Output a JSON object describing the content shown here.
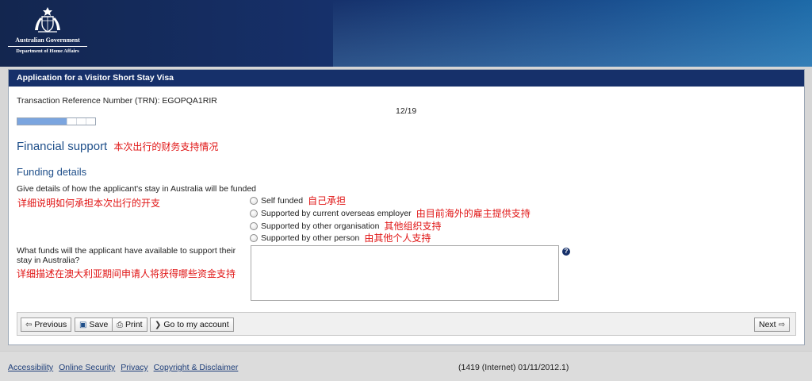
{
  "header": {
    "government": "Australian Government",
    "department": "Department of Home Affairs",
    "icon": "coat-of-arms-icon"
  },
  "panel": {
    "title": "Application for a Visitor Short Stay Visa"
  },
  "trn": "Transaction Reference Number (TRN): EGOPQA1RIR",
  "progress": {
    "label": "12/19",
    "fraction": 0.63
  },
  "section": {
    "title": "Financial support",
    "title_cn": "本次出行的财务支持情况",
    "subtitle": "Funding details"
  },
  "funding_question": {
    "label": "Give details of how the applicant's stay in Australia will be funded",
    "label_cn": "详细说明如何承担本次出行的开支",
    "options": [
      {
        "label": "Self funded",
        "cn": "自己承担"
      },
      {
        "label": "Supported by current overseas employer",
        "cn": "由目前海外的雇主提供支持"
      },
      {
        "label": "Supported by other organisation",
        "cn": "其他组织支持"
      },
      {
        "label": "Supported by other person",
        "cn": "由其他个人支持"
      }
    ]
  },
  "funds_question": {
    "label": "What funds will the applicant have available to support their stay in Australia?",
    "label_cn": "详细描述在澳大利亚期间申请人将获得哪些资金支持",
    "value": "",
    "help": "?"
  },
  "toolbar": {
    "previous": "Previous",
    "save": "Save",
    "print": "Print",
    "account": "Go to my account",
    "next": "Next"
  },
  "footer": {
    "links": [
      "Accessibility",
      "Online Security",
      "Privacy",
      "Copyright & Disclaimer"
    ],
    "version": "(1419 (Internet) 01/11/2012.1)"
  },
  "colors": {
    "brand_navy": "#16306a",
    "heading_blue": "#1f4f8a",
    "annotation_red": "#e01414",
    "progress_fill": "#7ba5df"
  }
}
